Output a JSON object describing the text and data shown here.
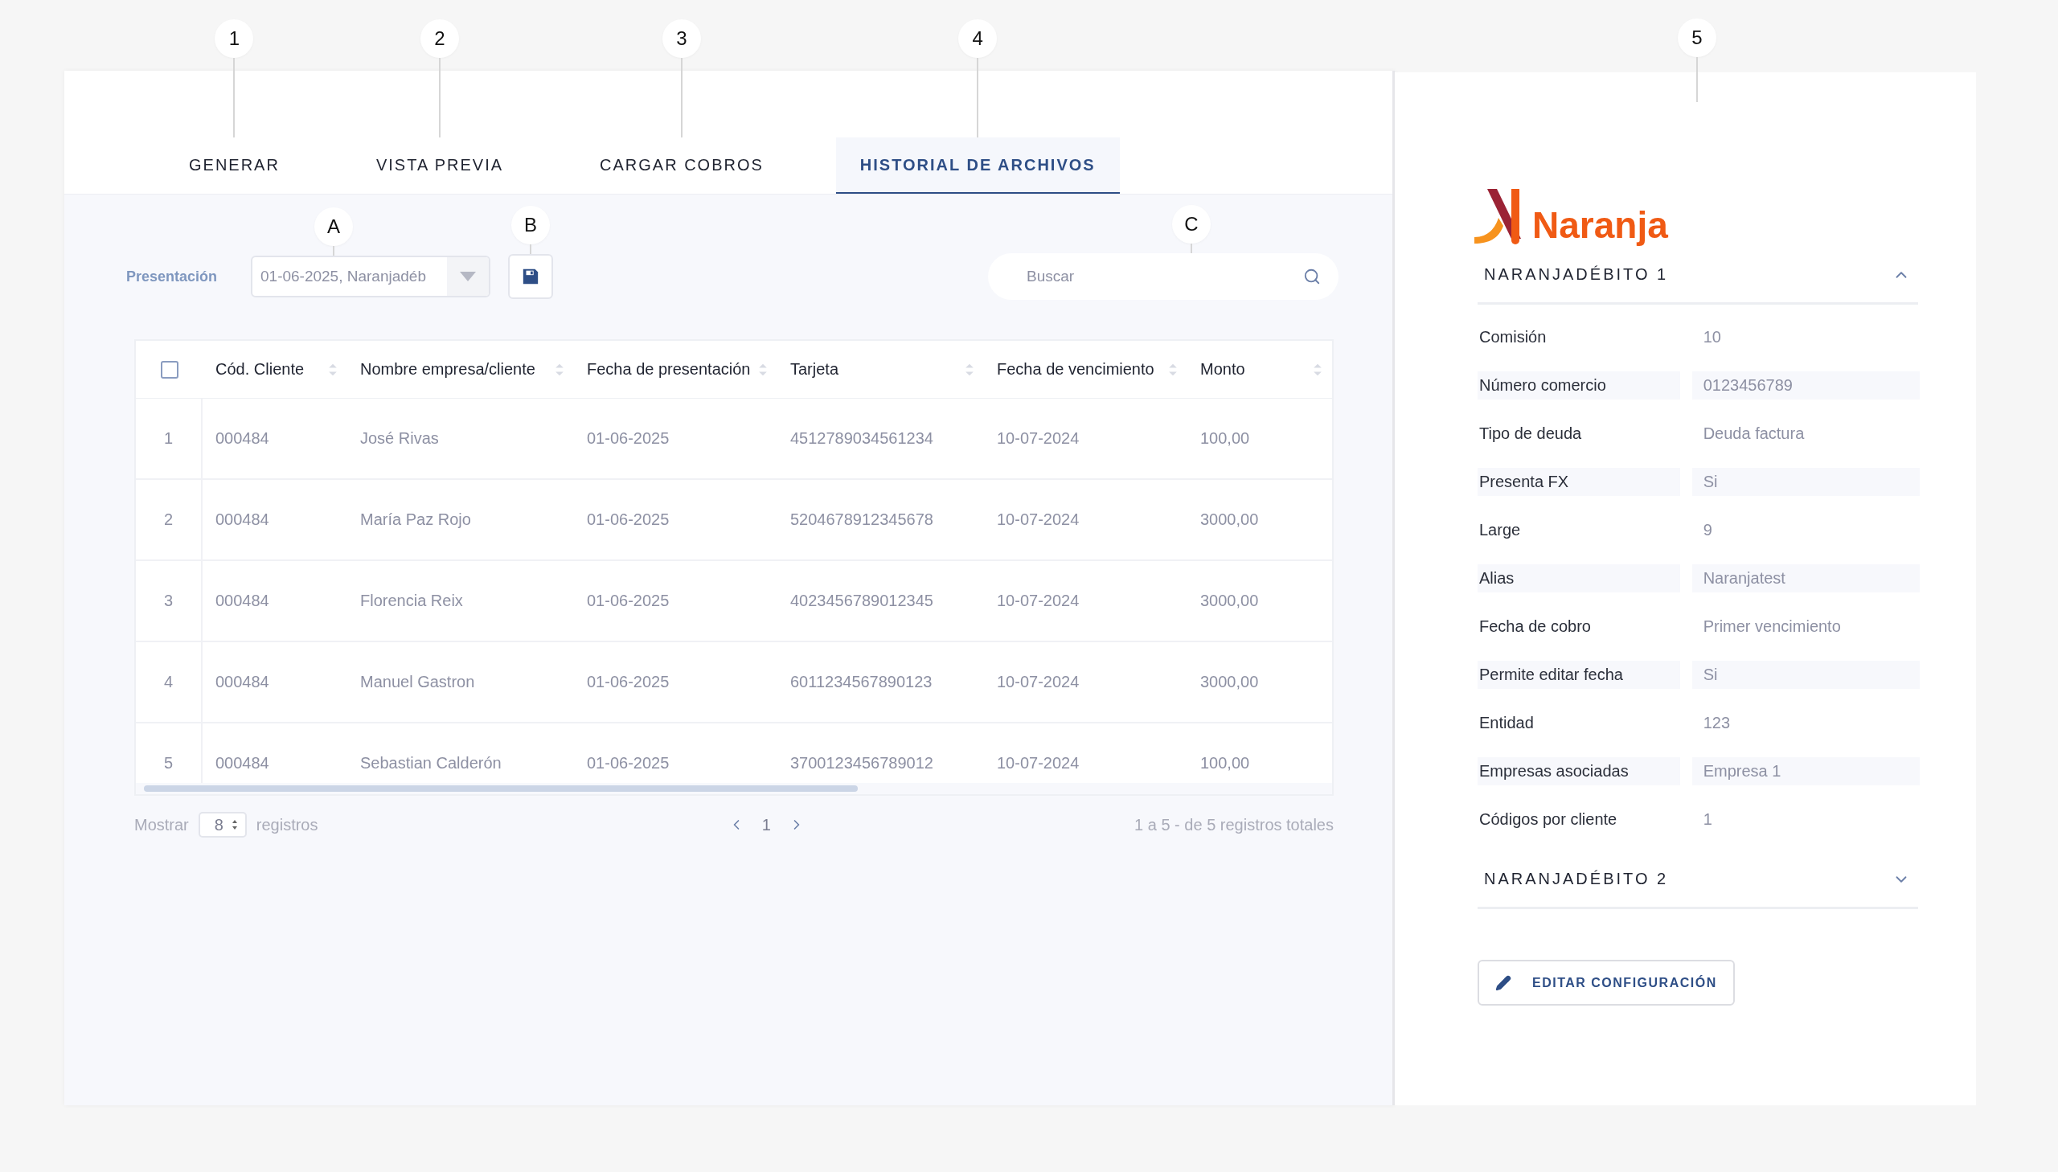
{
  "tabs": [
    {
      "label": "GENERAR",
      "marker": "1",
      "selected": false
    },
    {
      "label": "VISTA PREVIA",
      "marker": "2",
      "selected": false
    },
    {
      "label": "CARGAR COBROS",
      "marker": "3",
      "selected": false
    },
    {
      "label": "HISTORIAL DE ARCHIVOS",
      "marker": "4",
      "selected": true
    }
  ],
  "toolbar": {
    "label": "Presentación",
    "presentation": {
      "value": "01-06-2025, Naranjadéb",
      "marker": "A"
    },
    "save_marker": "B",
    "search": {
      "placeholder": "Buscar",
      "marker": "C"
    }
  },
  "table": {
    "select_all_checked": false,
    "columns": [
      "Cód. Cliente",
      "Nombre empresa/cliente",
      "Fecha de presentación",
      "Tarjeta",
      "Fecha de vencimiento",
      "Monto"
    ],
    "rows": [
      {
        "index": "1",
        "cells": [
          "000484",
          "José Rivas",
          "01-06-2025",
          "4512789034561234",
          "10-07-2024",
          "100,00"
        ]
      },
      {
        "index": "2",
        "cells": [
          "000484",
          "María Paz Rojo",
          "01-06-2025",
          "5204678912345678",
          "10-07-2024",
          "3000,00"
        ]
      },
      {
        "index": "3",
        "cells": [
          "000484",
          "Florencia Reix",
          "01-06-2025",
          "4023456789012345",
          "10-07-2024",
          "3000,00"
        ]
      },
      {
        "index": "4",
        "cells": [
          "000484",
          "Manuel Gastron",
          "01-06-2025",
          "6011234567890123",
          "10-07-2024",
          "3000,00"
        ]
      },
      {
        "index": "5",
        "cells": [
          "000484",
          "Sebastian Calderón",
          "01-06-2025",
          "3700123456789012",
          "10-07-2024",
          "100,00"
        ]
      }
    ]
  },
  "pagination": {
    "show_label": "Mostrar",
    "page_size": "8",
    "records_label": "registros",
    "page": "1",
    "total": "1 a 5 - de 5 registros totales"
  },
  "panel": {
    "marker": "5",
    "logo": "Naranja",
    "sections": [
      {
        "title": "NARANJADÉBITO 1",
        "expanded": true,
        "rows": [
          {
            "label": "Comisión",
            "value": "10"
          },
          {
            "label": "Número comercio",
            "value": "0123456789"
          },
          {
            "label": "Tipo de deuda",
            "value": "Deuda factura"
          },
          {
            "label": "Presenta FX",
            "value": "Si"
          },
          {
            "label": "Large",
            "value": "9"
          },
          {
            "label": "Alias",
            "value": "Naranjatest"
          },
          {
            "label": "Fecha de cobro",
            "value": "Primer vencimiento"
          },
          {
            "label": "Permite editar fecha",
            "value": "Si"
          },
          {
            "label": "Entidad",
            "value": "123"
          },
          {
            "label": "Empresas asociadas",
            "value": "Empresa 1"
          },
          {
            "label": "Códigos por cliente",
            "value": "1"
          }
        ]
      },
      {
        "title": "NARANJADÉBITO 2",
        "expanded": false
      }
    ],
    "button": "EDITAR CONFIGURACIÓN"
  }
}
